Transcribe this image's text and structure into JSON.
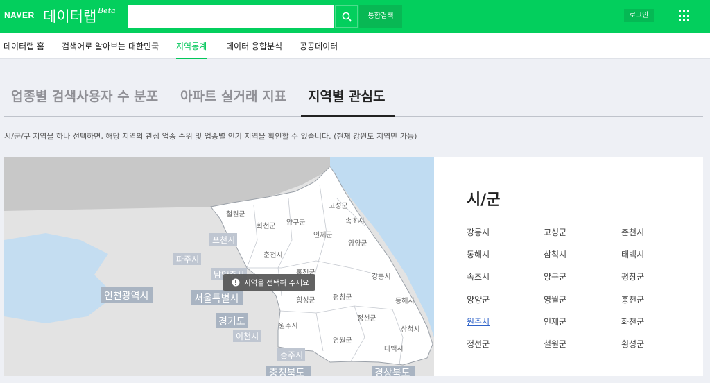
{
  "header": {
    "naver": "NAVER",
    "title": "데이터랩",
    "beta": "Beta",
    "search_value": "",
    "search_all": "통합검색",
    "login": "로그인"
  },
  "nav": {
    "items": [
      {
        "label": "데이터랩 홈"
      },
      {
        "label": "검색어로 알아보는 대한민국"
      },
      {
        "label": "지역통계"
      },
      {
        "label": "데이터 융합분석"
      },
      {
        "label": "공공데이터"
      }
    ]
  },
  "tabs": [
    {
      "label": "업종별 검색사용자 수 분포"
    },
    {
      "label": "아파트 실거래 지표"
    },
    {
      "label": "지역별 관심도"
    }
  ],
  "description": "시/군/구 지역을 하나 선택하면, 해당 지역의 관심 업종 순위 및 업종별 인기 지역을 확인할 수 있습니다. (현재 강원도 지역만 가능)",
  "map": {
    "tooltip": "지역을 선택해 주세요",
    "province_labels": [
      "인천광역시",
      "서울특별시",
      "경기도",
      "충청북도",
      "경상북도"
    ],
    "city_labels": [
      "포천시",
      "파주시",
      "남양주시",
      "이천시",
      "충주시"
    ],
    "gangwon_labels": [
      "철원군",
      "화천군",
      "양구군",
      "인제군",
      "고성군",
      "속초시",
      "양양군",
      "춘천시",
      "홍천군",
      "강릉시",
      "횡성군",
      "평창군",
      "동해시",
      "정선군",
      "원주시",
      "영월군",
      "삼척시",
      "태백시"
    ]
  },
  "panel": {
    "title": "시/군",
    "regions": [
      "강릉시",
      "고성군",
      "춘천시",
      "동해시",
      "삼척시",
      "태백시",
      "속초시",
      "양구군",
      "평창군",
      "양양군",
      "영월군",
      "홍천군",
      "원주시",
      "인제군",
      "화천군",
      "정선군",
      "철원군",
      "횡성군"
    ]
  }
}
